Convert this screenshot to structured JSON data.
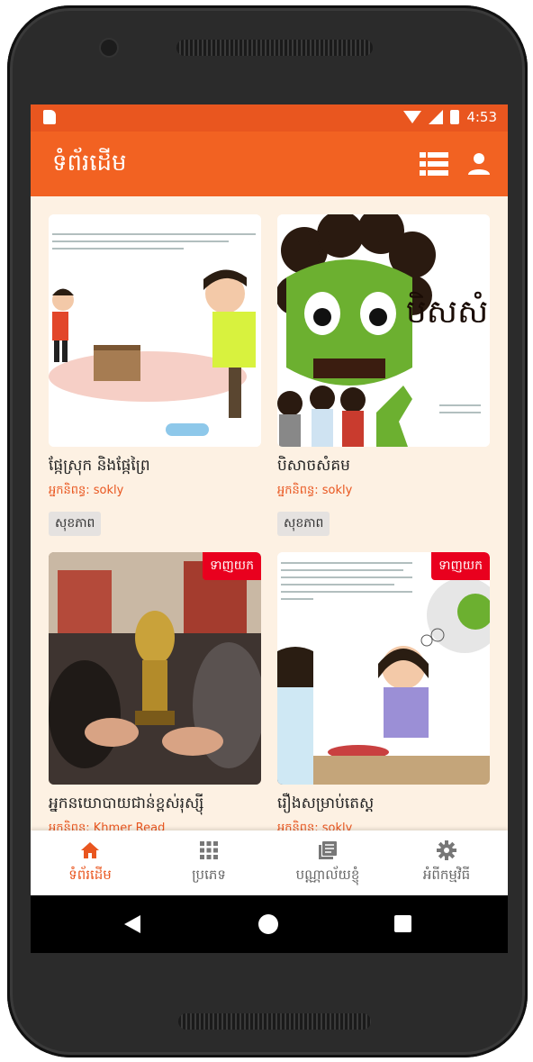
{
  "status_bar": {
    "time": "4:53"
  },
  "app_bar": {
    "title": "ទំព័រដើម",
    "list_icon": "list-view-icon",
    "user_icon": "user-icon"
  },
  "books": [
    {
      "title": "ផ្កែស្រុក និងផ្កែព្រៃ",
      "author": "អ្នកនិពន្ធ: sokly",
      "tag": "សុខភាព",
      "badge": ""
    },
    {
      "title": "បិសាចសំគម",
      "author": "អ្នកនិពន្ធ: sokly",
      "tag": "សុខភាព",
      "badge": "",
      "cover_text": "បិសសំគ"
    },
    {
      "title": "អ្នកនយោបាយជាន់ខ្ពស់រុស្ស៊ី",
      "author": "អ្នកនិពន្ធ: Khmer Read",
      "tag": "",
      "badge": "ទាញយក"
    },
    {
      "title": "រឿងសម្រាប់តេស្ត",
      "author": "អ្នកនិពន្ធ: sokly",
      "tag": "",
      "badge": "ទាញយក"
    }
  ],
  "bottom_nav": [
    {
      "label": "ទំព័រដើម",
      "icon": "home-icon",
      "active": true
    },
    {
      "label": "ប្រភេទ",
      "icon": "grid-icon",
      "active": false
    },
    {
      "label": "បណ្ណាល័យខ្ញុំ",
      "icon": "library-icon",
      "active": false
    },
    {
      "label": "អំពីកម្មវិធី",
      "icon": "gear-icon",
      "active": false
    }
  ],
  "colors": {
    "primary": "#f26222",
    "status_bar": "#e9561f",
    "badge": "#e9001e",
    "background": "#fdf1e3"
  }
}
